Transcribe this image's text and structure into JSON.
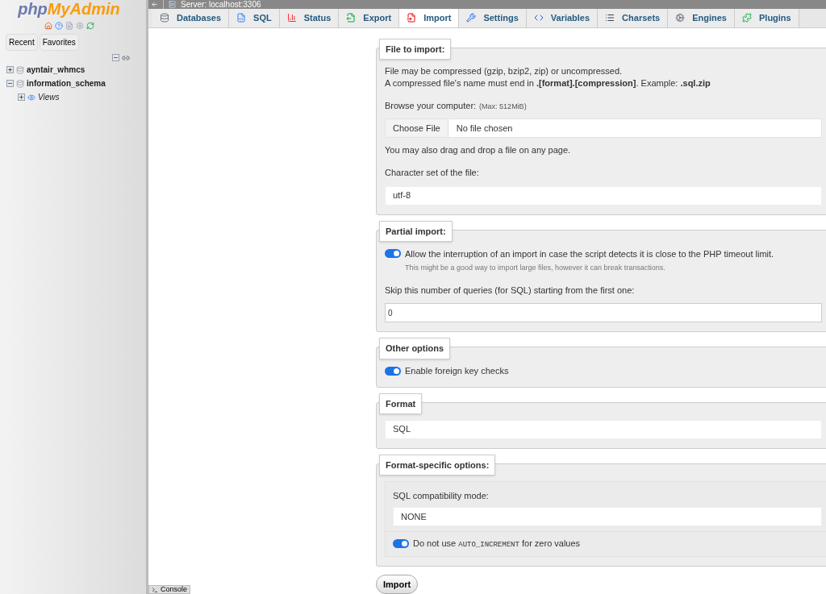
{
  "sidebar": {
    "logo": {
      "part1": "php",
      "part2": "MyAdmin"
    },
    "tabs": [
      {
        "label": "Recent",
        "selected": false
      },
      {
        "label": "Favorites",
        "selected": false
      }
    ],
    "tree": [
      {
        "label": "ayntair_whmcs",
        "expanded": false,
        "kind": "database"
      },
      {
        "label": "information_schema",
        "expanded": true,
        "kind": "database",
        "children": [
          {
            "label": "Views",
            "expanded": false,
            "kind": "folder"
          }
        ]
      }
    ]
  },
  "server_bar": {
    "title": "Server: localhost:3306"
  },
  "tabs": [
    {
      "label": "Databases",
      "selected": false
    },
    {
      "label": "SQL",
      "selected": false
    },
    {
      "label": "Status",
      "selected": false
    },
    {
      "label": "Export",
      "selected": false
    },
    {
      "label": "Import",
      "selected": true
    },
    {
      "label": "Settings",
      "selected": false
    },
    {
      "label": "Variables",
      "selected": false
    },
    {
      "label": "Charsets",
      "selected": false
    },
    {
      "label": "Engines",
      "selected": false
    },
    {
      "label": "Plugins",
      "selected": false
    }
  ],
  "sections": [
    {
      "legend": "File to import:",
      "items": [
        {
          "kind": "text",
          "text": "File may be compressed (gzip, bzip2, zip) or uncompressed.\nA compressed file's name must end in **.[format].[compression]**. Example: **.sql.zip**"
        },
        {
          "kind": "label",
          "text": "Browse your computer:",
          "note": "(Max: 512MiB)"
        },
        {
          "kind": "file",
          "button": "Choose File",
          "value": "No file chosen"
        },
        {
          "kind": "text",
          "text": "You may also drag and drop a file on any page."
        },
        {
          "kind": "label",
          "text": "Character set of the file:"
        },
        {
          "kind": "select",
          "value": "utf-8"
        }
      ]
    },
    {
      "legend": "Partial import:",
      "items": [
        {
          "kind": "toggle",
          "on": true,
          "text": "Allow the interruption of an import in case the script detects it is close to the PHP timeout limit.",
          "hint": "This might be a good way to import large files, however it can break transactions."
        },
        {
          "kind": "label",
          "text": "Skip this number of queries (for SQL) starting from the first one:"
        },
        {
          "kind": "input",
          "value": "0"
        }
      ]
    },
    {
      "legend": "Other options",
      "items": [
        {
          "kind": "toggle",
          "on": true,
          "text": "Enable foreign key checks"
        }
      ]
    },
    {
      "legend": "Format",
      "items": [
        {
          "kind": "select",
          "value": "SQL"
        }
      ]
    },
    {
      "legend": "Format-specific options:",
      "items": [
        {
          "kind": "group",
          "items": [
            {
              "kind": "label",
              "text": "SQL compatibility mode:"
            },
            {
              "kind": "select",
              "value": "NONE"
            },
            {
              "kind": "toggle",
              "on": true,
              "text": "Do not use",
              "code": "AUTO_INCREMENT",
              "after": "for zero values"
            }
          ]
        }
      ]
    }
  ],
  "submit": "Import",
  "console": "Console"
}
